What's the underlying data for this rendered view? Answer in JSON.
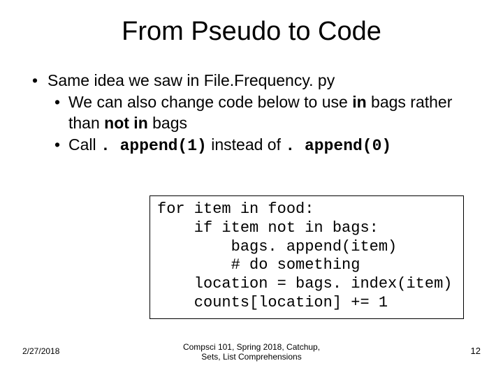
{
  "title": "From Pseudo to Code",
  "bullets": {
    "l1_text": "Same idea we saw in File.Frequency. py",
    "l2a_pre": "We can also change code below to use ",
    "l2a_in": "in",
    "l2a_mid": " bags rather than ",
    "l2a_notin": "not in",
    "l2a_post": " bags",
    "l2b_pre": "Call ",
    "l2b_code1": ". append(1)",
    "l2b_mid": " instead of ",
    "l2b_code2": ". append(0)"
  },
  "code": {
    "l1": "for item in food:",
    "l2": "    if item not in bags:",
    "l3": "        bags. append(item)",
    "l4": "        # do something",
    "l5": "    location = bags. index(item)",
    "l6": "    counts[location] += 1"
  },
  "footer": {
    "date": "2/27/2018",
    "center_line1": "Compsci 101, Spring 2018,  Catchup,",
    "center_line2": "Sets, List Comprehensions",
    "page": "12"
  }
}
